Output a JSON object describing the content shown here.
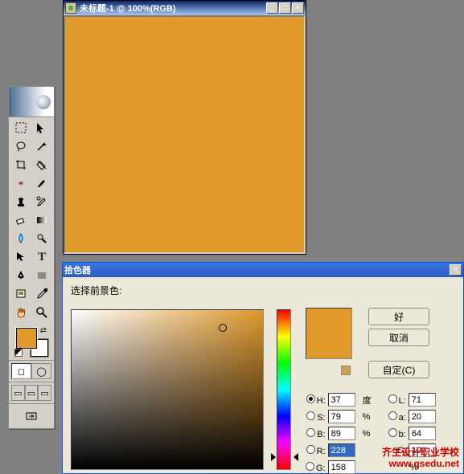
{
  "doc": {
    "title": "未标题-1 @ 100%(RGB)",
    "fill": "#e0992b"
  },
  "tools": {
    "fg_color": "#e0992b",
    "bg_color": "#ffffff"
  },
  "picker": {
    "title": "拾色器",
    "label": "选择前景色:",
    "buttons": {
      "ok": "好",
      "cancel": "取消",
      "custom": "自定(C)"
    },
    "sv_marker": {
      "left_pct": 79,
      "top_pct": 11
    },
    "hue_top_pct": 90,
    "hsb": {
      "h": "37",
      "s": "79",
      "b": "89"
    },
    "lab": {
      "l": "71",
      "a": "20",
      "b2": "64"
    },
    "rgb": {
      "r": "228",
      "g": "158"
    },
    "cval": "10",
    "units": {
      "deg": "度",
      "pct": "%"
    },
    "labels": {
      "H": "H:",
      "S": "S:",
      "B": "B:",
      "L": "L:",
      "a": "a:",
      "b": "b:",
      "R": "R:",
      "G": "G:",
      "C": "C:"
    }
  },
  "watermark": {
    "cn": "齐生设计职业学校",
    "url": "www.qsedu.net"
  }
}
